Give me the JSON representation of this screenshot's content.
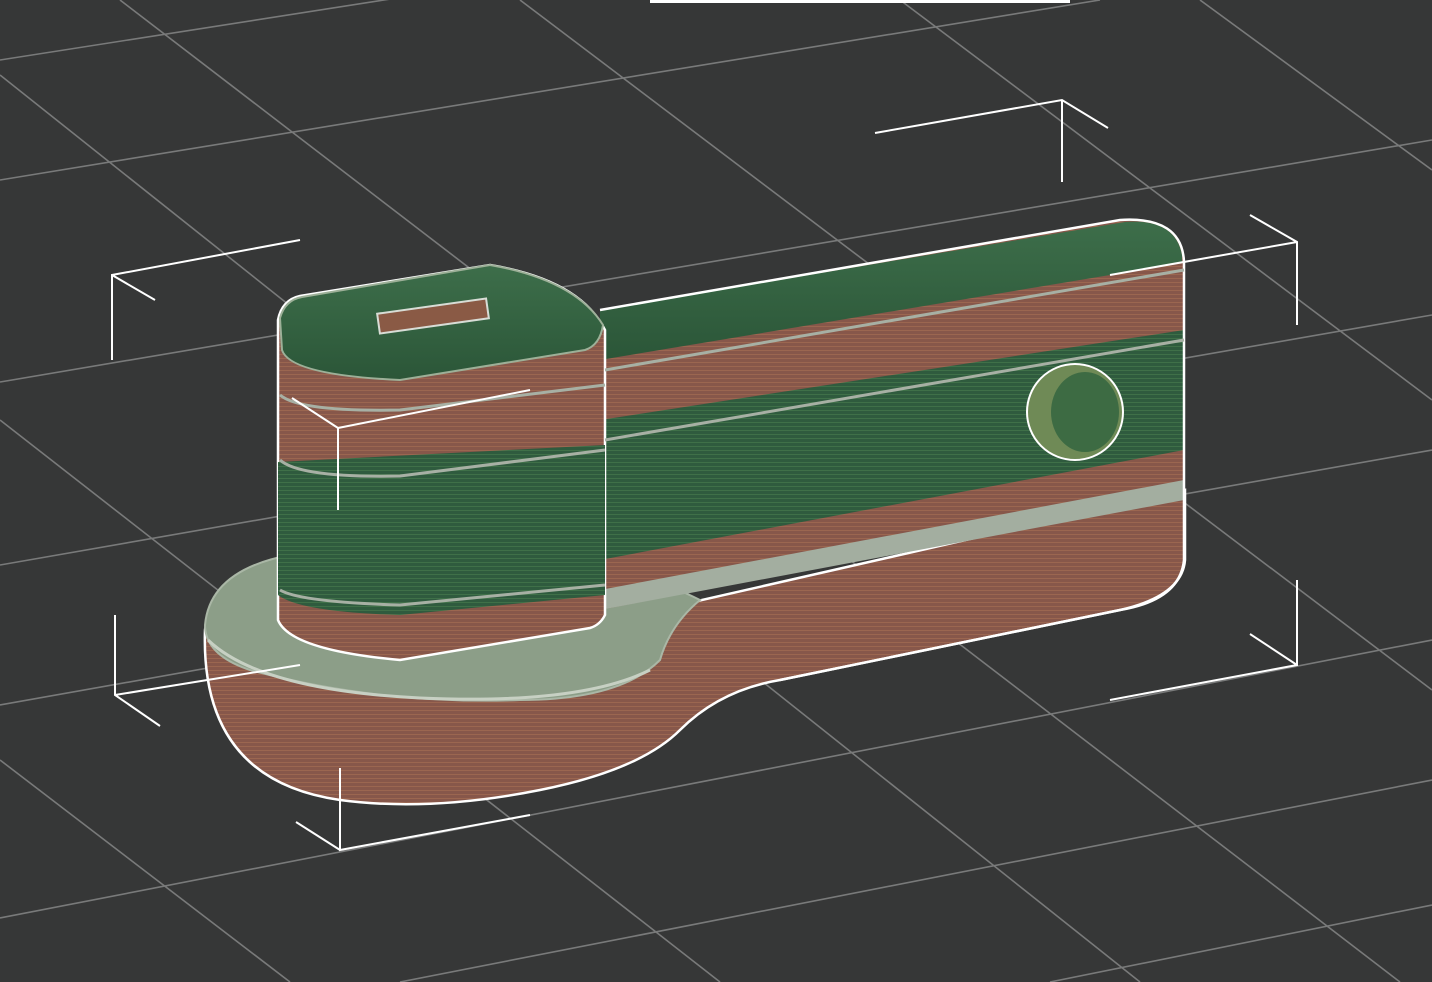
{
  "app": {
    "view": "3d-preview",
    "object": "sliced-lever-arm-part"
  },
  "colors": {
    "background": "#363737",
    "grid_line": "#8e8f8f",
    "bounding_box": "#ffffff",
    "layer_green": "#2f5f3f",
    "layer_green_light": "#4a7d4f",
    "layer_orange": "#8a5a45",
    "layer_orange_light": "#a06a50",
    "layer_gray": "#8a9888",
    "base_top": "#8c9e88"
  },
  "icons": {
    "object": "3d-model-icon"
  }
}
